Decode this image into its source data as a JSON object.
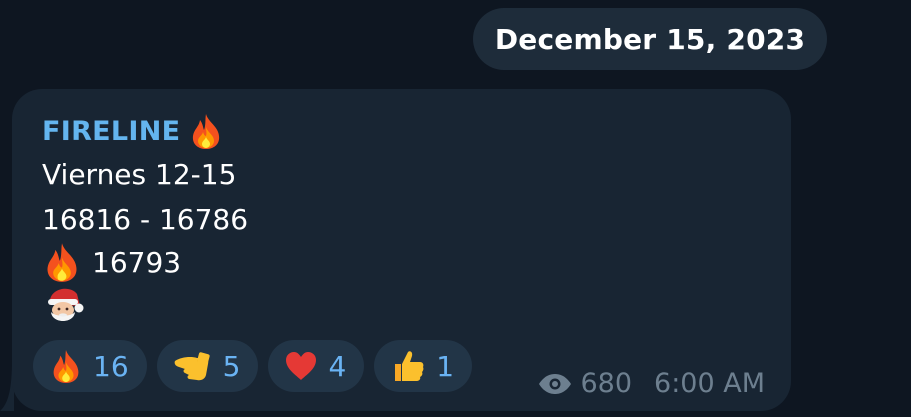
{
  "date_separator": "December 15, 2023",
  "message": {
    "sender": "FIRELINE",
    "lines": {
      "day": "Viernes 12-15",
      "range": "16816 - 16786",
      "fire_value": "16793"
    },
    "reactions": [
      {
        "emoji": "fire-icon",
        "count": "16"
      },
      {
        "emoji": "saluting-hand-icon",
        "count": "5"
      },
      {
        "emoji": "heart-icon",
        "count": "4"
      },
      {
        "emoji": "thumbs-up-icon",
        "count": "1"
      }
    ],
    "views": "680",
    "time": "6:00 AM"
  },
  "colors": {
    "background": "#0e1621",
    "bubble": "#182533",
    "sender": "#64b5ef",
    "reaction_count": "#6ab3f3",
    "meta": "#6d7f8f"
  }
}
